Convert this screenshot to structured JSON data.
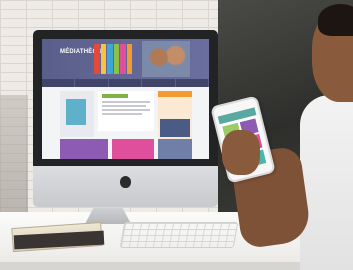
{
  "screen_site": {
    "logo_text": "MÉDIATHÈQUE"
  },
  "colors": {
    "header": "#5a5f8a",
    "accent_green": "#7cb342",
    "accent_orange": "#f39a32",
    "tile_purple": "#8d5bb3",
    "tile_pink": "#e04f9b",
    "phone_teal": "#59a9a0"
  },
  "icons": [
    "apple-logo-icon"
  ]
}
